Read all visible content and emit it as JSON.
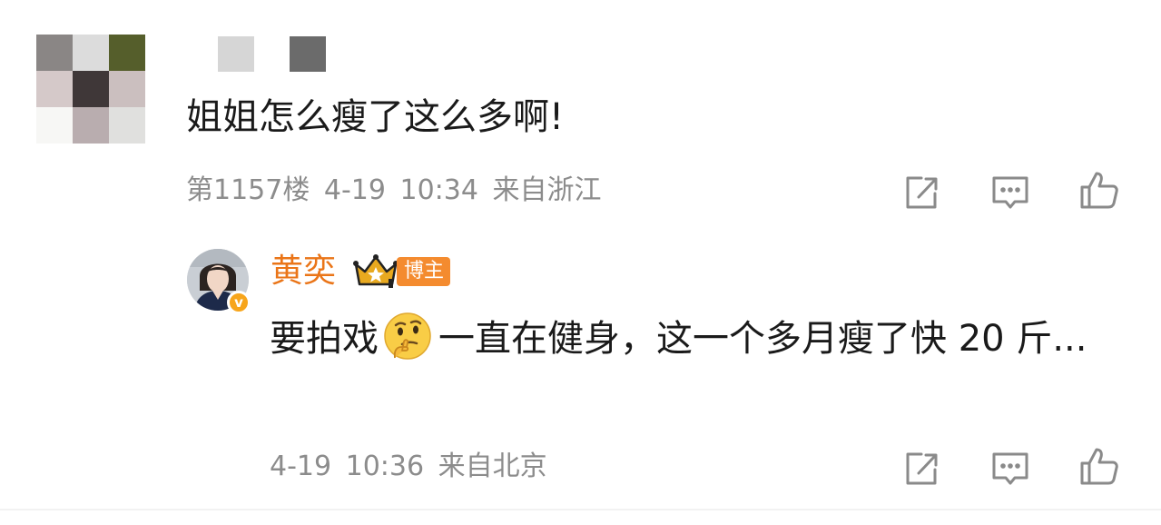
{
  "comment": {
    "avatar_colors": [
      "#8a8685",
      "#dcdcdc",
      "#555e2b",
      "#d5c9c9",
      "#3f3738",
      "#cbbfbf",
      "#f7f7f5",
      "#b9adaf",
      "#e0e0de"
    ],
    "username_block_colors": [
      "#d6d6d6",
      "#6b6b6b"
    ],
    "text": "姐姐怎么瘦了这么多啊!",
    "meta": "第1157楼 4-19 10:34 来自浙江"
  },
  "reply": {
    "username": "黄奕",
    "author_badge": "博主",
    "text_before_emoji": "要拍戏",
    "emoji": "thinking-face",
    "text_after_emoji": "一直在健身，这一个多月瘦了快 20 斤...",
    "meta": "4-19 10:36 来自北京"
  },
  "icons": {
    "share": "share-icon",
    "comment": "comment-icon",
    "like": "thumbs-up-icon",
    "crown": "crown-icon",
    "verified": "verified-v-icon"
  },
  "colors": {
    "username_accent": "#ea7518",
    "badge_bg": "#f48b2f",
    "meta_text": "#8c8c8c",
    "icon_stroke": "#8a8a8a",
    "verified": "#f7a51b"
  }
}
